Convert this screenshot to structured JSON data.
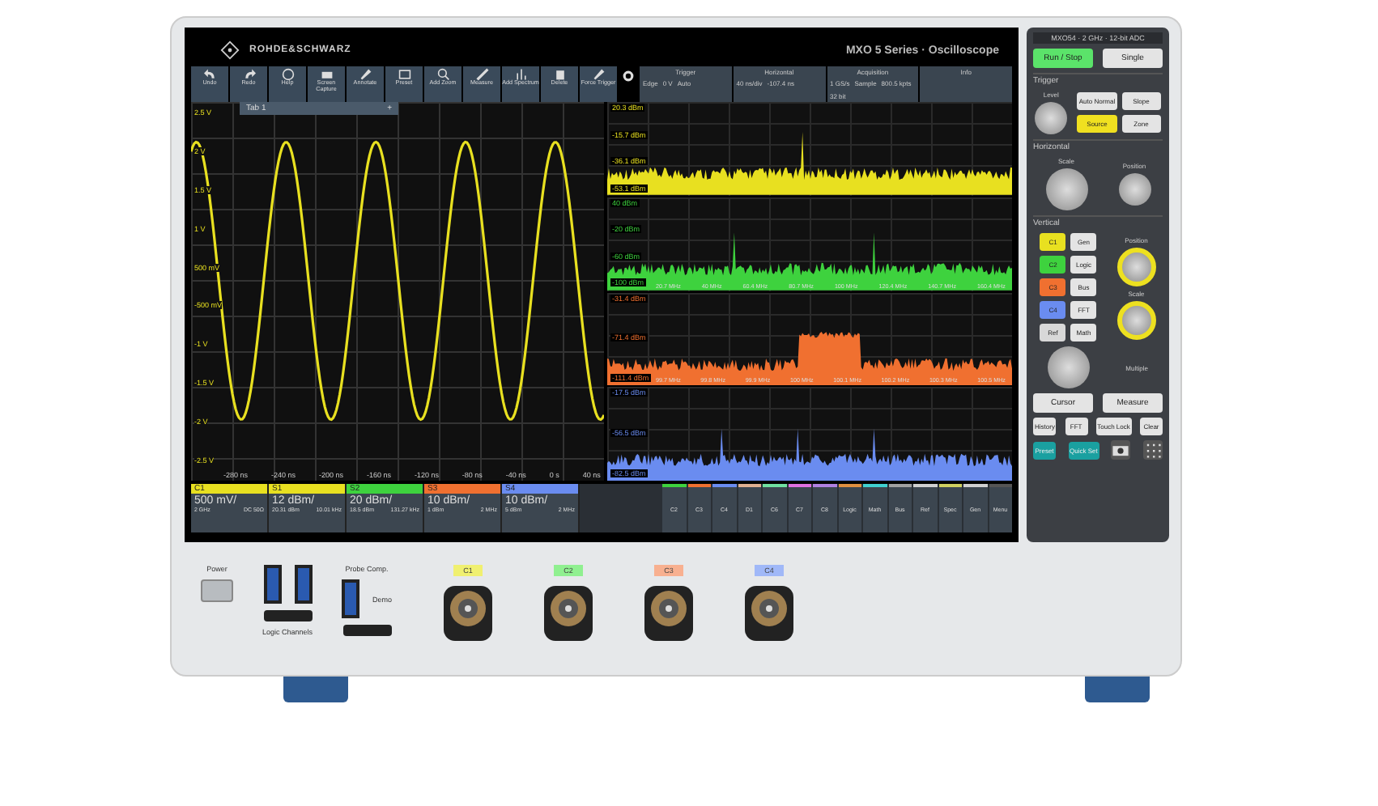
{
  "screen": {
    "brand": "ROHDE&SCHWARZ",
    "title": "MXO 5 Series · Oscilloscope"
  },
  "toolbar": [
    "Undo",
    "Redo",
    "Help",
    "Screen Capture",
    "Annotate",
    "Preset",
    "Add Zoom",
    "Measure",
    "Add Spectrum",
    "Delete",
    "Force Trigger"
  ],
  "info_panels": [
    {
      "title": "Trigger",
      "values": [
        "Edge",
        "0 V",
        "Auto"
      ]
    },
    {
      "title": "Horizontal",
      "values": [
        "40 ns/div",
        "-107.4 ns"
      ]
    },
    {
      "title": "Acquisition",
      "values": [
        "1 GS/s",
        "Sample",
        "800.5 kpts",
        "32 bit"
      ]
    },
    {
      "title": "Info"
    }
  ],
  "time_plot": {
    "tab": "Tab 1",
    "tab_add": "+",
    "y_labels": [
      "2.5 V",
      "2 V",
      "1.5 V",
      "1 V",
      "500 mV",
      "-500 mV",
      "-1 V",
      "-1.5 V",
      "-2 V",
      "-2.5 V"
    ],
    "x_labels": [
      "-280 ns",
      "-240 ns",
      "-200 ns",
      "-160 ns",
      "-120 ns",
      "-80 ns",
      "-40 ns",
      "0 s",
      "40 ns"
    ],
    "color": "#e8e020"
  },
  "spectra": [
    {
      "color": "#e8e020",
      "kind": "peak",
      "levels": [
        "20.3 dBm",
        "-15.7 dBm",
        "-36.1 dBm",
        "-53.1 dBm"
      ]
    },
    {
      "color": "#3ed23e",
      "kind": "flat",
      "levels": [
        "40 dBm",
        "-20 dBm",
        "-60 dBm",
        "-100 dBm"
      ],
      "freqs": [
        "20.7 MHz",
        "40 MHz",
        "60.4 MHz",
        "80.7 MHz",
        "100 MHz",
        "120.4 MHz",
        "140.7 MHz",
        "160.4 MHz"
      ]
    },
    {
      "color": "#f07030",
      "kind": "band",
      "levels": [
        "-31.4 dBm",
        "-71.4 dBm",
        "-111.4 dBm"
      ],
      "freqs": [
        "99.7 MHz",
        "99.8 MHz",
        "99.9 MHz",
        "100 MHz",
        "100.1 MHz",
        "100.2 MHz",
        "100.3 MHz",
        "100.5 MHz"
      ]
    },
    {
      "color": "#6a8cf0",
      "kind": "peaks",
      "levels": [
        "-17.5 dBm",
        "-56.5 dBm",
        "-82.5 dBm"
      ]
    }
  ],
  "channels": [
    {
      "label": "C1",
      "color": "#e8e020",
      "scale": "500 mV/",
      "info": [
        "2 GHz",
        "DC 50Ω"
      ]
    },
    {
      "label": "S1",
      "color": "#e8e020",
      "scale": "12 dBm/",
      "info": [
        "20.31 dBm",
        "10.01 kHz"
      ]
    },
    {
      "label": "S2",
      "color": "#3ed23e",
      "scale": "20 dBm/",
      "info": [
        "18.5 dBm",
        "131.27 kHz"
      ]
    },
    {
      "label": "S3",
      "color": "#f07030",
      "scale": "10 dBm/",
      "info": [
        "1 dBm",
        "2 MHz"
      ]
    },
    {
      "label": "S4",
      "color": "#6a8cf0",
      "scale": "10 dBm/",
      "info": [
        "5 dBm",
        "2 MHz"
      ]
    }
  ],
  "channel_buttons": [
    {
      "label": "C2",
      "color": "#3ed23e"
    },
    {
      "label": "C3",
      "color": "#f07030"
    },
    {
      "label": "C4",
      "color": "#6a8cf0"
    },
    {
      "label": "D1",
      "color": "#e0b090"
    },
    {
      "label": "C6",
      "color": "#70e0a0"
    },
    {
      "label": "C7",
      "color": "#e070e0"
    },
    {
      "label": "C8",
      "color": "#b080e0"
    },
    {
      "label": "Logic",
      "color": "#e09040"
    },
    {
      "label": "Math",
      "color": "#40d0d0"
    },
    {
      "label": "Bus",
      "color": "#a0a0a0"
    },
    {
      "label": "Ref",
      "color": "#d0d0d0"
    },
    {
      "label": "Spec",
      "color": "#d0d060"
    },
    {
      "label": "Gen",
      "color": "#d0d0d0"
    },
    {
      "label": "Menu",
      "color": "#555555"
    }
  ],
  "panel": {
    "model": "MXO54 · 2 GHz · 12-bit ADC",
    "run_stop": "Run / Stop",
    "single": "Single",
    "trigger": "Trigger",
    "level": "Level",
    "auto_normal": "Auto Normal",
    "slope": "Slope",
    "source": "Source",
    "zone": "Zone",
    "horizontal": "Horizontal",
    "scale": "Scale",
    "position": "Position",
    "vertical": "Vertical",
    "channel_keys": [
      {
        "label": "C1",
        "color": "#e8e020"
      },
      {
        "label": "C2",
        "color": "#3ed23e"
      },
      {
        "label": "C3",
        "color": "#f07030"
      },
      {
        "label": "C4",
        "color": "#6a8cf0"
      },
      {
        "label": "Ref",
        "color": "#d8d8d8"
      }
    ],
    "function_keys": [
      "Gen",
      "Logic",
      "Bus",
      "FFT",
      "Math"
    ],
    "v_position": "Position",
    "v_scale": "Scale",
    "multi": "Multiple",
    "cursor": "Cursor",
    "measure": "Measure",
    "bottom_keys": [
      "History",
      "FFT",
      "Touch Lock",
      "Clear"
    ],
    "teal_keys": [
      "Preset",
      "Quick Set"
    ]
  },
  "front": {
    "power": "Power",
    "probe_comp": "Probe Comp.",
    "demo": "Demo",
    "logic_channels": "Logic Channels",
    "inputs": [
      {
        "label": "C1",
        "color": "#f0f070"
      },
      {
        "label": "C2",
        "color": "#90f090"
      },
      {
        "label": "C3",
        "color": "#f8b090"
      },
      {
        "label": "C4",
        "color": "#a0b8f8"
      }
    ]
  }
}
